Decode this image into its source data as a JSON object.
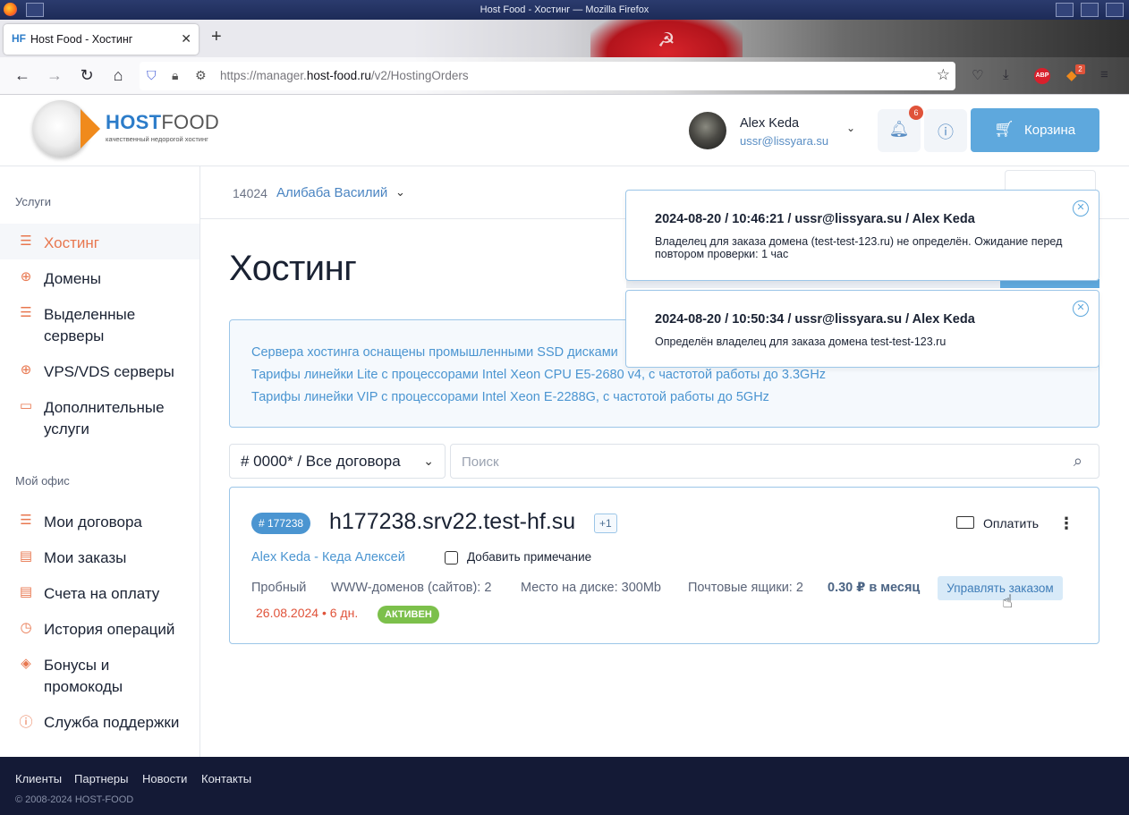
{
  "window": {
    "title": "Host Food - Хостинг — Mozilla Firefox"
  },
  "browser": {
    "tab_label": "Host Food - Хостинг",
    "tab_favicon": "HF",
    "url_prefix": "https://manager.",
    "url_domain": "host-food.ru",
    "url_path": "/v2/HostingOrders",
    "extension_abp": "ABP",
    "extension_badge": "2"
  },
  "site": {
    "logo_host": "HOST",
    "logo_food": "FOOD",
    "logo_tagline": "качественный недорогой хостинг",
    "user_name": "Alex Keda",
    "user_email": "ussr@lissyara.su",
    "notifications_count": "6",
    "cart_label": "Корзина"
  },
  "sidebar": {
    "services_title": "Услуги",
    "services": [
      {
        "label": "Хостинг",
        "icon": "server-stack-icon"
      },
      {
        "label": "Домены",
        "icon": "globe-icon"
      },
      {
        "label": "Выделенные серверы",
        "icon": "server-icon"
      },
      {
        "label": "VPS/VDS серверы",
        "icon": "globe-icon"
      },
      {
        "label": "Дополнительные услуги",
        "icon": "addon-icon"
      }
    ],
    "office_title": "Мой офис",
    "office": [
      {
        "label": "Мои договора",
        "icon": "contracts-icon"
      },
      {
        "label": "Мои заказы",
        "icon": "orders-icon"
      },
      {
        "label": "Счета на оплату",
        "icon": "invoice-icon"
      },
      {
        "label": "История операций",
        "icon": "history-icon"
      },
      {
        "label": "Бонусы и промокоды",
        "icon": "tag-icon"
      },
      {
        "label": "Служба поддержки",
        "icon": "help-icon"
      }
    ]
  },
  "contract": {
    "number": "14024",
    "name": "Алибаба Василий"
  },
  "page": {
    "title": "Хостинг",
    "info_lines": [
      "Сервера хостинга оснащены промышленными SSD дисками",
      "Тарифы линейки Lite с процессорами Intel Xeon CPU E5-2680 v4, с частотой работы до 3.3GHz",
      "Тарифы линейки VIP с процессорами Intel Xeon E-2288G, с частотой работы до 5GHz"
    ],
    "filter_value": "# 0000* / Все договора",
    "search_placeholder": "Поиск"
  },
  "order": {
    "id": "# 177238",
    "host": "h177238.srv22.test-hf.su",
    "extra": "+1",
    "pay_label": "Оплатить",
    "client": "Alex Keda - Кеда Алексей",
    "note_label": "Добавить примечание",
    "tariff": "Пробный",
    "domains": "WWW-доменов (сайтов): 2",
    "disk": "Место на диске: 300Mb",
    "mailboxes": "Почтовые ящики: 2",
    "price": "0.30 ₽ в месяц",
    "manage_label": "Управлять заказом",
    "expires": "26.08.2024 • 6 дн.",
    "status": "АКТИВЕН"
  },
  "toasts": [
    {
      "header": "2024-08-20 / 10:46:21 / ussr@lissyara.su / Alex Keda",
      "body": "Владелец для заказа домена (test-test-123.ru) не определён. Ожидание перед повтором проверки: 1 час"
    },
    {
      "header": "2024-08-20 / 10:50:34 / ussr@lissyara.su / Alex Keda",
      "body": "Определён владелец для заказа домена test-test-123.ru"
    }
  ],
  "footer": {
    "links": [
      "Клиенты",
      "Партнеры",
      "Новости",
      "Контакты"
    ],
    "copyright": "© 2008-2024 HOST-FOOD"
  },
  "colors": {
    "accent": "#5ea8dd",
    "active_nav": "#e8774f",
    "status_active": "#7cc04b",
    "footer_bg": "#141a36"
  }
}
